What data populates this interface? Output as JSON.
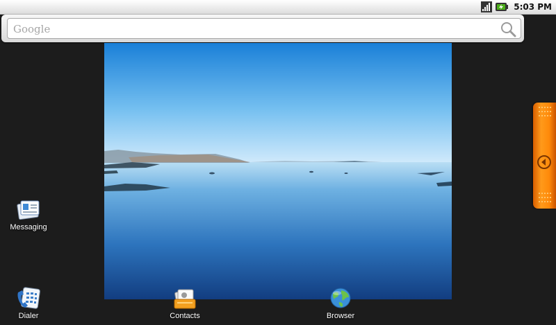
{
  "status_bar": {
    "time": "5:03 PM"
  },
  "search": {
    "placeholder": "Google"
  },
  "apps": {
    "messaging": "Messaging",
    "dialer": "Dialer",
    "contacts": "Contacts",
    "browser": "Browser"
  },
  "colors": {
    "drawer_handle": "#ff8a0a",
    "background": "#1c1c1c"
  }
}
